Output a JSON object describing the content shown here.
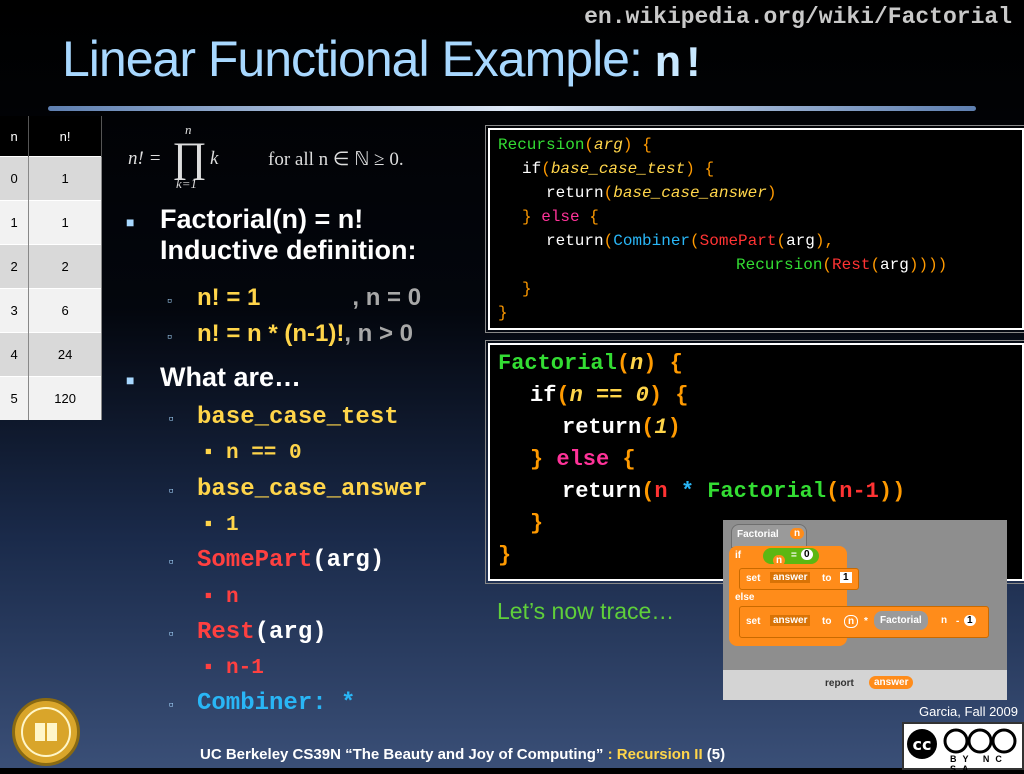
{
  "url": "en.wikipedia.org/wiki/Factorial",
  "title": {
    "text": "Linear Functional Example: ",
    "mono": "n!"
  },
  "table": {
    "headers": [
      "n",
      "n!"
    ],
    "rows": [
      [
        "0",
        "1"
      ],
      [
        "1",
        "1"
      ],
      [
        "2",
        "2"
      ],
      [
        "3",
        "6"
      ],
      [
        "4",
        "24"
      ],
      [
        "5",
        "120"
      ]
    ]
  },
  "formula": {
    "lhs": "n! =",
    "top": "n",
    "bottom": "k=1",
    "term": "k",
    "condition": "for all n ∈ ℕ ≥ 0."
  },
  "bullets": {
    "factorial_line1": "Factorial(n) = n!",
    "factorial_line2": "Inductive definition:",
    "def1_left": "n! = 1",
    "def1_right": ", n = 0",
    "def2_left": "n! = n * (n-1)!",
    "def2_right": ", n > 0",
    "what_are": "What are…",
    "base_case_test": "base_case_test",
    "base_case_test_val": "n == 0",
    "base_case_answer": "base_case_answer",
    "base_case_answer_val": "1",
    "somepart": "SomePart",
    "somepart_arg": "(arg)",
    "somepart_val": "n",
    "rest": "Rest",
    "rest_arg": "(arg)",
    "rest_val": "n-1",
    "combiner": "Combiner: *"
  },
  "recursion_code": {
    "l1_name": "Recursion",
    "l1_open": "(",
    "l1_arg": "arg",
    "l1_close": ")",
    "l1_brace": "{",
    "l2_if": "if",
    "l2_open": "(",
    "l2_test": "base_case_test",
    "l2_close": ")",
    "l2_brace": "{",
    "l3_return": "return",
    "l3_open": "(",
    "l3_ans": "base_case_answer",
    "l3_close": ")",
    "l4_brace": "}",
    "l4_else": "else",
    "l4_brace2": "{",
    "l5_return": "return",
    "l5_open": "(",
    "l5_comb": "Combiner",
    "l5_p2": "(",
    "l5_some": "SomePart",
    "l5_p3": "(",
    "l5_arg": "arg",
    "l5_p4": "),",
    "l6_rec": "Recursion",
    "l6_p1": "(",
    "l6_rest": "Rest",
    "l6_p2": "(",
    "l6_arg": "arg",
    "l6_p3": "))))",
    "l7_brace": "}",
    "l8_brace": "}"
  },
  "factorial_code": {
    "l1_name": "Factorial",
    "l1_open": "(",
    "l1_arg": "n",
    "l1_close": ")",
    "l1_brace": "{",
    "l2_if": "if",
    "l2_open": "(",
    "l2_test": "n == 0",
    "l2_close": ")",
    "l2_brace": "{",
    "l3_return": "return",
    "l3_open": "(",
    "l3_val": "1",
    "l3_close": ")",
    "l4_brace": "}",
    "l4_else": "else",
    "l4_brace2": "{",
    "l5_return": "return",
    "l5_open": "(",
    "l5_n": "n",
    "l5_star": "*",
    "l5_fact": "Factorial",
    "l5_p2": "(",
    "l5_arg": "n-1",
    "l5_p3": "))",
    "l6_brace": "}",
    "l7_brace": "}"
  },
  "trace": "Let’s now trace…",
  "scratch": {
    "hat_label": "Factorial",
    "hat_param": "n",
    "if": "if",
    "n": "n",
    "eq": "=",
    "zero": "0",
    "set": "set",
    "answer": "answer",
    "to": "to",
    "one": "1",
    "else": "else",
    "set2": "set",
    "answer2": "answer",
    "to2": "to",
    "n2": "n",
    "star": "*",
    "fact": "Factorial",
    "n3": "n",
    "minus": "-",
    "one2": "1",
    "report": "report",
    "report_var": "answer"
  },
  "signature": "Garcia, Fall 2009",
  "footer": {
    "course": "UC Berkeley CS39N “The Beauty and Joy of Computing”",
    "colon": " : ",
    "topic": "Recursion II",
    "page": "(5)"
  },
  "license": "BY NC SA"
}
